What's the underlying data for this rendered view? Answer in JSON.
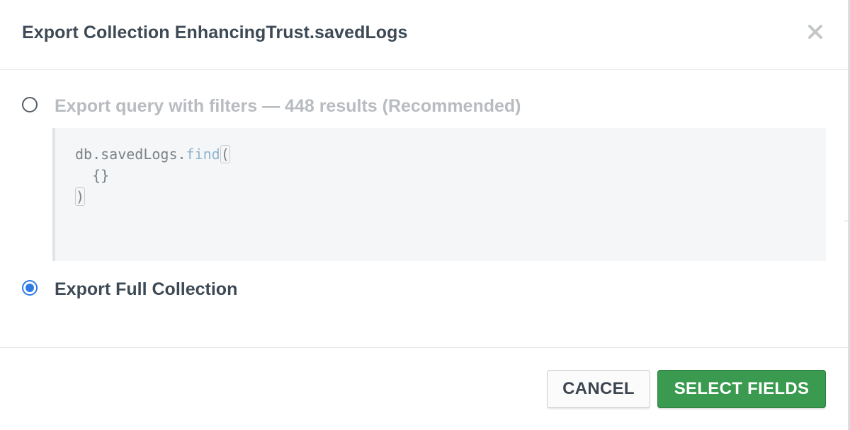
{
  "dialog": {
    "title": "Export Collection EnhancingTrust.savedLogs",
    "close_icon": "close-icon"
  },
  "options": [
    {
      "label": "Export query with filters — 448 results (Recommended)",
      "selected": false,
      "disabled": true
    },
    {
      "label": "Export Full Collection",
      "selected": true,
      "disabled": false
    }
  ],
  "query": {
    "prefix": "db.savedLogs.",
    "function": "find",
    "open_paren": "(",
    "argument": "{}",
    "close_paren": ")"
  },
  "footer": {
    "cancel_label": "CANCEL",
    "select_fields_label": "SELECT FIELDS"
  },
  "colors": {
    "accent_radio": "#2f7be6",
    "primary_button": "#3a9a4f",
    "disabled_text": "#b8bcc0"
  }
}
